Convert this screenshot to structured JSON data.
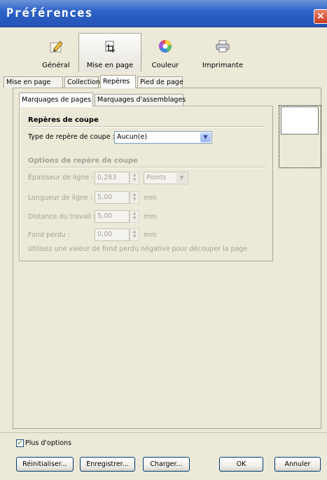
{
  "window": {
    "title": "Préférences",
    "close_glyph": "×"
  },
  "categories": [
    {
      "label": "Général",
      "icon": "pencil-note-icon"
    },
    {
      "label": "Mise en page",
      "icon": "crop-icon",
      "active": true
    },
    {
      "label": "Couleur",
      "icon": "color-wheel-icon"
    },
    {
      "label": "Imprimante",
      "icon": "printer-icon"
    }
  ],
  "tabs": [
    "Mise en page",
    "Collection",
    "Repères",
    "Pied de page"
  ],
  "active_tab": "Repères",
  "subtabs": [
    "Marquages de pages",
    "Marquages d'assemblages"
  ],
  "active_subtab": "Marquages de pages",
  "crop_marks": {
    "section_title": "Repères de coupe",
    "type_label": "Type de repère de coupe :",
    "type_value": "Aucun(e)"
  },
  "crop_options": {
    "section_title": "Options de repère de coupe",
    "line_width_label": "Épaisseur de ligne :",
    "line_width_value": "0,283",
    "line_width_unit": "Points",
    "line_length_label": "Longueur de ligne :",
    "line_length_value": "5,00",
    "line_length_unit": "mm",
    "distance_label": "Distance du travail :",
    "distance_value": "5,00",
    "distance_unit": "mm",
    "bleed_label": "Fond perdu :",
    "bleed_value": "0,00",
    "bleed_unit": "mm",
    "hint": "Utilisez une valeur de fond perdu négative pour découper la page"
  },
  "more_options": {
    "label": "Plus d'options",
    "checked": true,
    "glyph": "✓"
  },
  "buttons": {
    "reset": "Réinitialiser...",
    "save": "Enregistrer...",
    "load": "Charger...",
    "ok": "OK",
    "cancel": "Annuler"
  },
  "colors": {
    "titlebar": "#2f63c8",
    "close": "#c83b1a",
    "background": "#ece9d8"
  }
}
